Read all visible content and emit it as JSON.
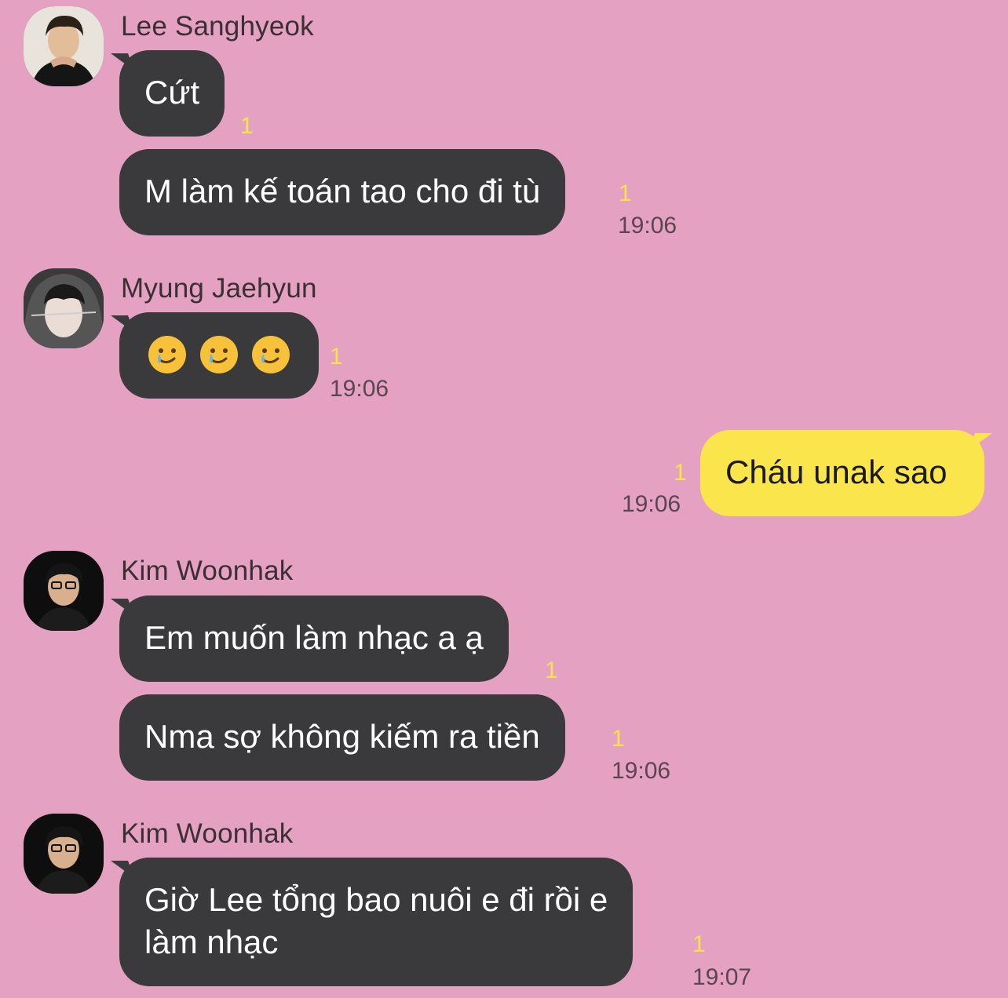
{
  "messages": [
    {
      "sender": "Lee Sanghyeok",
      "text": "Cứt",
      "unread": "1"
    },
    {
      "text": "M làm kế toán tao cho đi tù",
      "unread": "1",
      "time": "19:06"
    },
    {
      "sender": "Myung Jaehyun",
      "emoji": [
        "smiling-face-with-tear",
        "smiling-face-with-tear",
        "smiling-face-with-tear"
      ],
      "unread": "1",
      "time": "19:06"
    },
    {
      "self": true,
      "text": "Cháu unak sao",
      "unread": "1",
      "time": "19:06"
    },
    {
      "sender": "Kim Woonhak",
      "text": "Em muốn làm nhạc a ạ",
      "unread": "1"
    },
    {
      "text": "Nma sợ không kiếm ra tiền",
      "unread": "1",
      "time": "19:06"
    },
    {
      "sender": "Kim Woonhak",
      "text_lines": [
        "Giờ Lee tổng bao nuôi e đi rồi e",
        "làm nhạc"
      ],
      "unread": "1",
      "time": "19:07"
    }
  ],
  "colors": {
    "background": "#e5a1c1",
    "incoming_bubble": "#3a3a3c",
    "outgoing_bubble": "#fbe54d",
    "unread_count": "#f8e44a"
  }
}
